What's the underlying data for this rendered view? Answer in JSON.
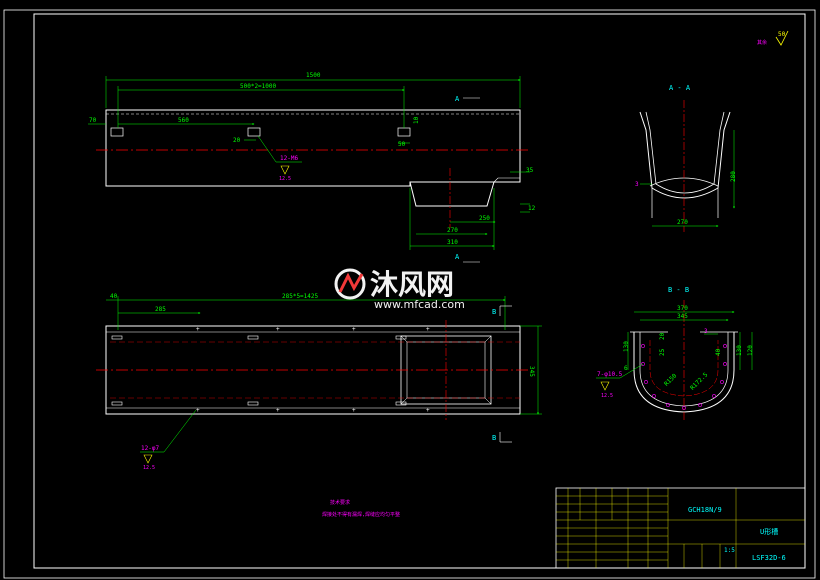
{
  "colors": {
    "background": "#000000",
    "frame": "#ffffff",
    "outline": "#ffffff",
    "dimension": "#00ff00",
    "centerline": "#ff0000",
    "annotation": "#ff00ff",
    "title_text": "#00ffff",
    "title_grid": "#ffff00"
  },
  "roughness": {
    "symbol_label": "50"
  },
  "view_top": {
    "dims": {
      "overall": "1500",
      "pitch": "500*2=1000",
      "offset_left": "70",
      "first_hole": "560",
      "hole_gap": "20",
      "flange_height": "10",
      "hole_width": "50",
      "right_step": "35",
      "outlet_bottom": "270",
      "outlet_inner": "250",
      "outlet_top": "310",
      "outlet_drop": "12"
    },
    "hole_note": "12-M6",
    "hole_rough": "12.5"
  },
  "section_aa": {
    "title": "A - A",
    "marker_top": "A",
    "marker_bottom": "A",
    "thickness": "3",
    "depth": "280",
    "width": "270"
  },
  "view_plan": {
    "dims": {
      "left_offset": "40",
      "first_pitch": "285",
      "pitch_total": "285*5=1425",
      "width": "345"
    },
    "hole_note": "12-φ7",
    "hole_rough": "12.5",
    "marker_top": "B",
    "marker_bottom": "B"
  },
  "section_bb": {
    "title": "B - B",
    "outer_width": "370",
    "inner_width": "345",
    "thickness": "3",
    "height_left": "130",
    "height_right": "130",
    "height_outer": "120",
    "flange_note": "7-φ10.5",
    "flange_rough": "12.5",
    "radius_inner": "R150",
    "radius_outer": "R172.5",
    "small_dims": [
      "20",
      "40",
      "25",
      "6"
    ]
  },
  "watermark": {
    "brand": "沐风网",
    "url": "www.mfcad.com"
  },
  "notes": {
    "title": "技术要求",
    "line": "焊接处不得有漏焊,焊缝应均匀平整"
  },
  "title_block": {
    "part_code": "GCH18N/9",
    "part_name": "U形槽",
    "drawing_no": "LSF32D-6",
    "scale": "1:5"
  }
}
